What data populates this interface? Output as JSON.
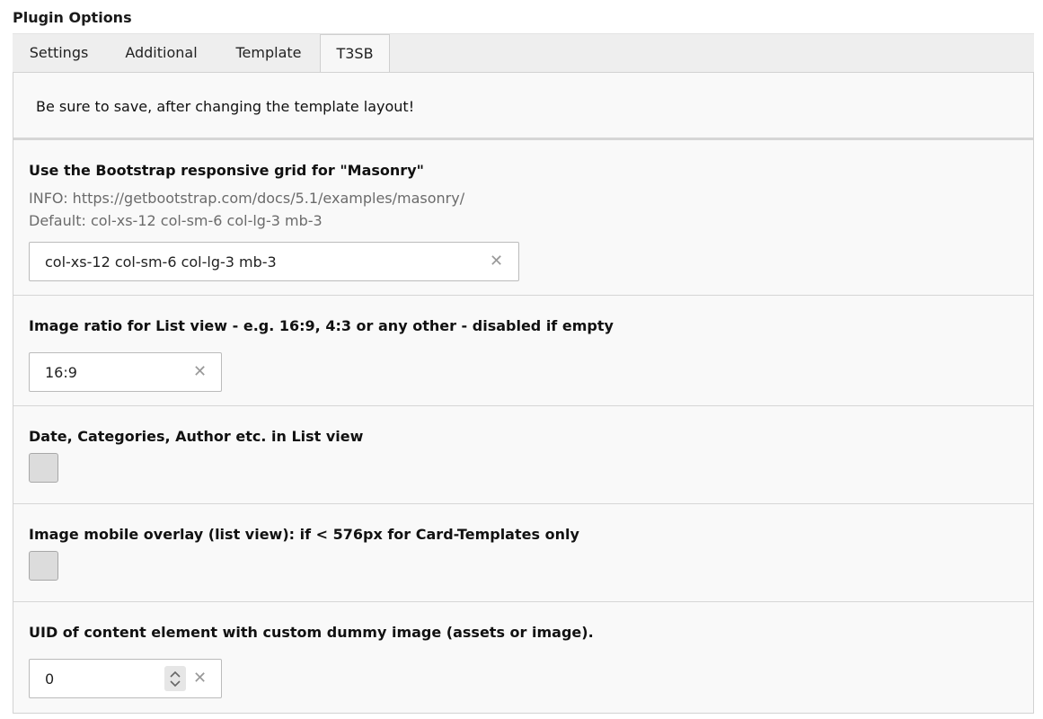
{
  "page": {
    "title": "Plugin Options"
  },
  "tabs": [
    {
      "label": "Settings"
    },
    {
      "label": "Additional"
    },
    {
      "label": "Template"
    },
    {
      "label": "T3SB",
      "active": true
    }
  ],
  "notice": {
    "text": "Be sure to save, after changing the template layout!"
  },
  "fields": {
    "masonry": {
      "label": "Use the Bootstrap responsive grid for \"Masonry\"",
      "info": "INFO: https://getbootstrap.com/docs/5.1/examples/masonry/",
      "default": "Default: col-xs-12 col-sm-6 col-lg-3 mb-3",
      "value": "col-xs-12 col-sm-6 col-lg-3 mb-3"
    },
    "image_ratio": {
      "label": "Image ratio for List view - e.g. 16:9, 4:3 or any other - disabled if empty",
      "value": "16:9"
    },
    "list_meta": {
      "label": "Date, Categories, Author etc. in List view",
      "checked": false
    },
    "mobile_overlay": {
      "label": "Image mobile overlay (list view): if < 576px for Card-Templates only",
      "checked": false
    },
    "dummy_image_uid": {
      "label": "UID of content element with custom dummy image (assets or image).",
      "value": "0"
    }
  },
  "icons": {
    "clear": "clear-icon",
    "stepper": "stepper-icon"
  },
  "colors": {
    "panel_bg": "#f9f9f9",
    "tab_bar_bg": "#eeeeee",
    "border": "#d2d2d2"
  }
}
